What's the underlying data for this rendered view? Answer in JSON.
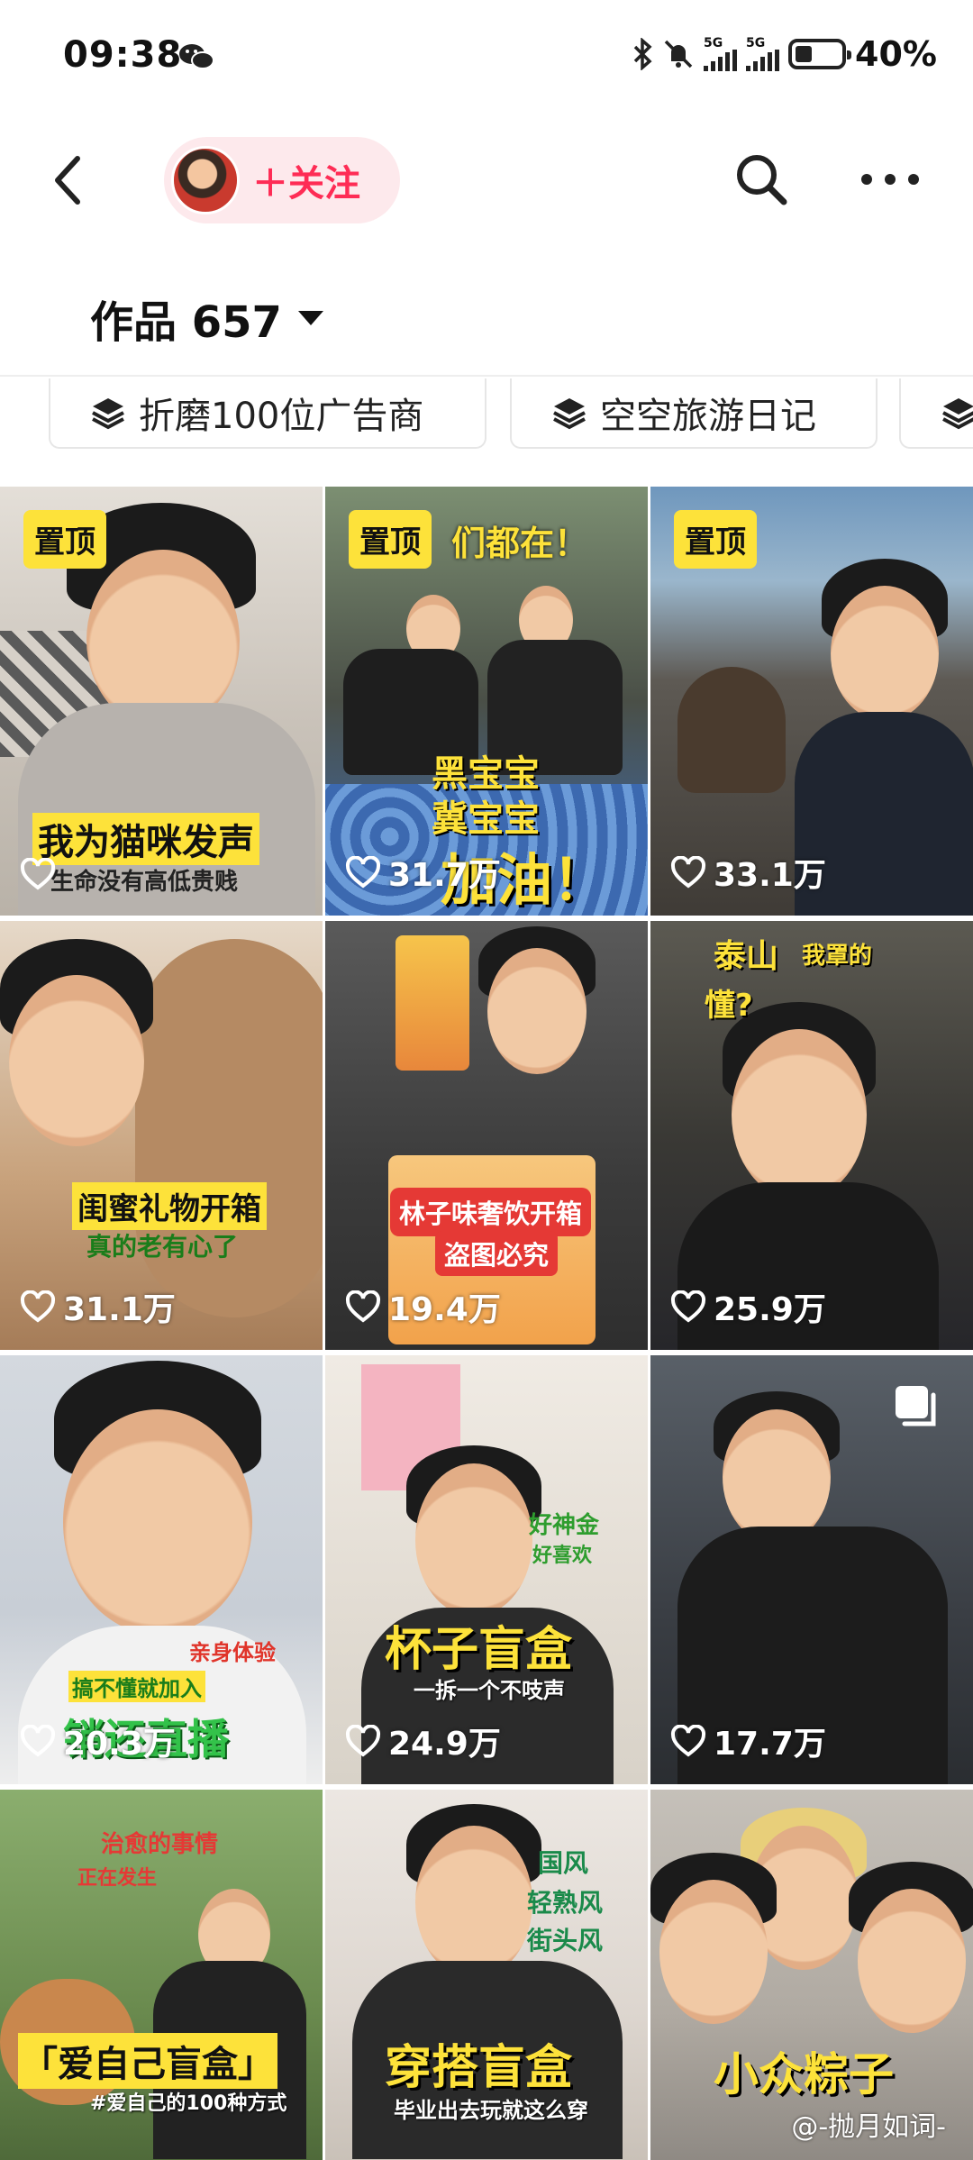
{
  "status_bar": {
    "time": "09:38",
    "net1": "5G",
    "net2": "5G",
    "battery": "40%",
    "battery_level": 0.4
  },
  "header": {
    "follow_label": "＋关注"
  },
  "works": {
    "label": "作品 657"
  },
  "collections": [
    {
      "label": "折磨100位广告商"
    },
    {
      "label": "空空旅游日记"
    }
  ],
  "videos": [
    {
      "pinned": "置顶",
      "likes": "",
      "caption": "我为猫咪发声",
      "sub": "生命没有高低贵贱",
      "bg": "#d9d3cb"
    },
    {
      "pinned": "置顶",
      "likes": "31.7万",
      "caption": "加油！",
      "caption2": "黑宝宝",
      "caption3": "冀宝宝",
      "top": "们都在！",
      "bg": "#6f7f6a"
    },
    {
      "pinned": "置顶",
      "likes": "33.1万",
      "bg": "#6a8aa8"
    },
    {
      "likes": "31.1万",
      "caption": "闺蜜礼物开箱",
      "sub": "真的老有心了",
      "bg": "#c7a17c"
    },
    {
      "likes": "19.4万",
      "caption": "林子味奢饮开箱",
      "sub": "盗图必究",
      "bg": "#3a3a3a"
    },
    {
      "likes": "25.9万",
      "caption": "泰山",
      "caption2": "我罩的",
      "caption3": "懂?",
      "bg": "#4a4a46"
    },
    {
      "likes": "20.3万",
      "caption": "销还直播",
      "sub": "搞不懂就加入",
      "sub2": "亲身体验",
      "bg": "#d8dde3"
    },
    {
      "likes": "24.9万",
      "caption": "杯子盲盒",
      "sub": "一拆一个不吱声",
      "sub2": "好神金",
      "sub3": "好喜欢",
      "bg": "#ece6dc"
    },
    {
      "likes": "17.7万",
      "bg": "#3c4046"
    },
    {
      "caption": "「爱自己盲盒」",
      "sub": "#爱自己的100种方式",
      "sub2": "治愈的事情",
      "sub3": "正在发生",
      "bg": "#6b8a4e"
    },
    {
      "caption": "穿搭盲盒",
      "sub": "毕业出去玩就这么穿",
      "sub2": "国风",
      "sub3": "轻熟风",
      "sub4": "街头风",
      "bg": "#e9e4df"
    },
    {
      "caption": "小众粽子",
      "bg": "#b9b4ad"
    }
  ],
  "watermark": "@-抛月如词-",
  "colors": {
    "accent": "#fe2c55",
    "pin": "#fde23a",
    "follow_bg": "#fde9ec"
  },
  "icons": [
    "back-icon",
    "search-icon",
    "more-icon",
    "collection-icon",
    "heart-icon",
    "multi-image-icon",
    "wechat-icon",
    "bluetooth-icon",
    "mute-icon"
  ]
}
